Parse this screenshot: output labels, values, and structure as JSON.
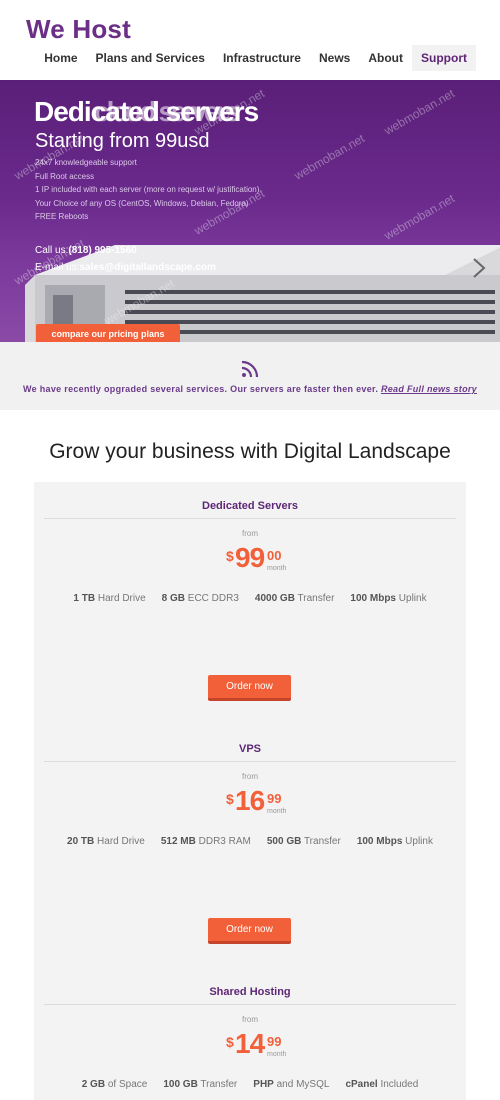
{
  "brand": {
    "name": "We Host",
    "accent": "#6b2f86",
    "cta_color": "#f2603a"
  },
  "nav": {
    "items": [
      {
        "label": "Home"
      },
      {
        "label": "Plans and Services"
      },
      {
        "label": "Infrastructure"
      },
      {
        "label": "News"
      },
      {
        "label": "About"
      },
      {
        "label": "Support"
      }
    ],
    "active": "Support"
  },
  "hero": {
    "title": "Dedicated servers",
    "title_overlap": "cloud servers",
    "subtitle": "Starting from 99usd",
    "features": [
      "24x7 knowledgeable support",
      "Full Root access",
      "1 IP included with each server (more on request w/ justification)",
      "Your Choice of any OS (CentOS, Windows, Debian, Fedora)",
      "FREE Reboots"
    ],
    "call_label": "Call us:",
    "phone": "(818) 995-1560",
    "email_label": "E-mail us:",
    "email": "sales@digitallandscape.com",
    "cta": "compare our pricing plans",
    "next_icon": "chevron-right-icon"
  },
  "watermark": "webmoban.net",
  "news": {
    "icon": "rss-icon",
    "text": "We have recently opgraded several services. Our servers are faster then ever.",
    "link": "Read Full news story"
  },
  "headline": "Grow your business with Digital Landscape",
  "plans": [
    {
      "name": "Dedicated Servers",
      "from": "from",
      "currency": "$",
      "price_int": "99",
      "price_dec": "00",
      "period": "month",
      "specs": [
        {
          "value": "1 TB",
          "label": "Hard Drive"
        },
        {
          "value": "8 GB",
          "label": "ECC DDR3"
        },
        {
          "value": "4000 GB",
          "label": "Transfer"
        },
        {
          "value": "100 Mbps",
          "label": "Uplink"
        }
      ],
      "button": "Order now"
    },
    {
      "name": "VPS",
      "from": "from",
      "currency": "$",
      "price_int": "16",
      "price_dec": "99",
      "period": "month",
      "specs": [
        {
          "value": "20 TB",
          "label": "Hard Drive"
        },
        {
          "value": "512 MB",
          "label": "DDR3 RAM"
        },
        {
          "value": "500 GB",
          "label": "Transfer"
        },
        {
          "value": "100 Mbps",
          "label": "Uplink"
        }
      ],
      "button": "Order now"
    },
    {
      "name": "Shared Hosting",
      "from": "from",
      "currency": "$",
      "price_int": "14",
      "price_dec": "99",
      "period": "month",
      "specs": [
        {
          "value": "2 GB",
          "label": "of Space"
        },
        {
          "value": "100 GB",
          "label": "Transfer"
        },
        {
          "value": "PHP",
          "label": "and MySQL"
        },
        {
          "value": "cPanel",
          "label": "Included"
        }
      ],
      "button": "Order now"
    }
  ]
}
